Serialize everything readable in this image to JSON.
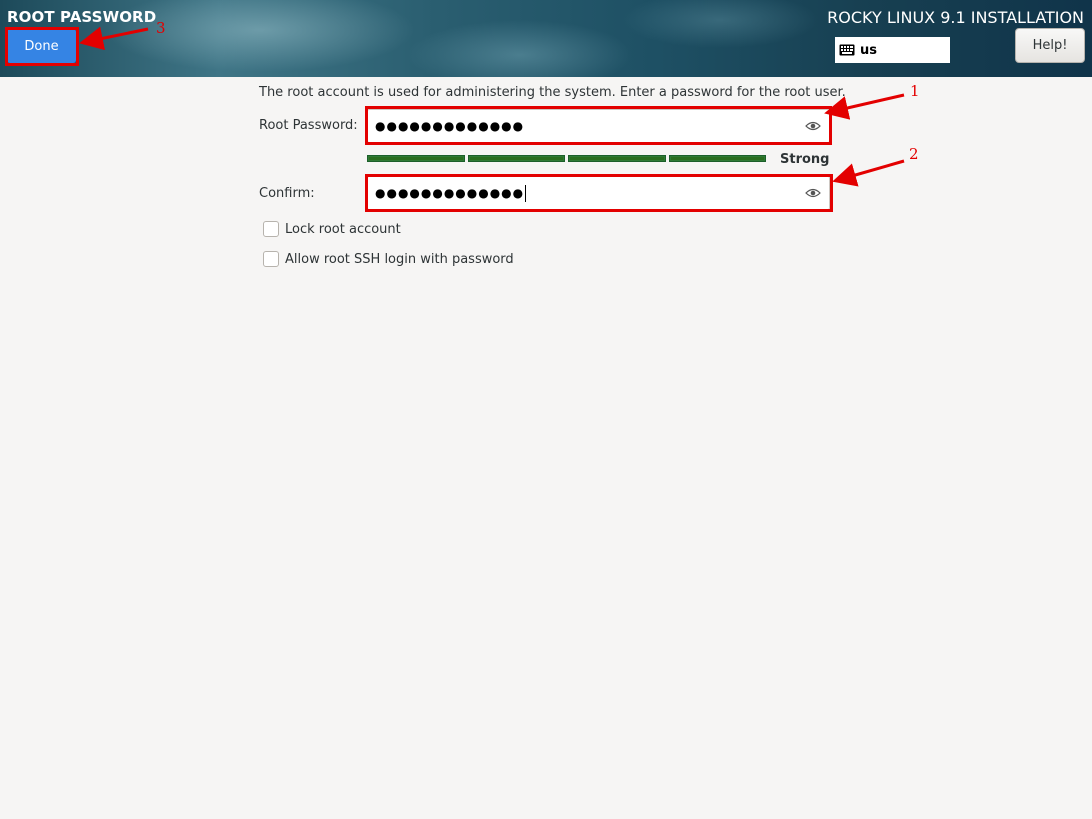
{
  "header": {
    "spoke_title": "ROOT PASSWORD",
    "product_title": "ROCKY LINUX 9.1 INSTALLATION",
    "done_label": "Done",
    "keyboard_layout": "us",
    "keyboard_icon": "keyboard-icon",
    "help_label": "Help!"
  },
  "form": {
    "intro": "The root account is used for administering the system.  Enter a password for the root user.",
    "root_password_label": "Root Password:",
    "root_password_value": "●●●●●●●●●●●●●",
    "confirm_label": "Confirm:",
    "confirm_value": "●●●●●●●●●●●●●",
    "reveal_icon": "eye-icon",
    "strength_label": "Strong",
    "strength_level": 1.0,
    "lock_root_label": "Lock root account",
    "lock_root_checked": false,
    "allow_ssh_label": "Allow root SSH login with password",
    "allow_ssh_checked": false
  },
  "annotations": {
    "labels": [
      "1",
      "2",
      "3"
    ],
    "color": "#e30000"
  },
  "colors": {
    "accent": "#3584e4",
    "strength_bar": "#2a6d1f",
    "background": "#f6f5f4"
  }
}
